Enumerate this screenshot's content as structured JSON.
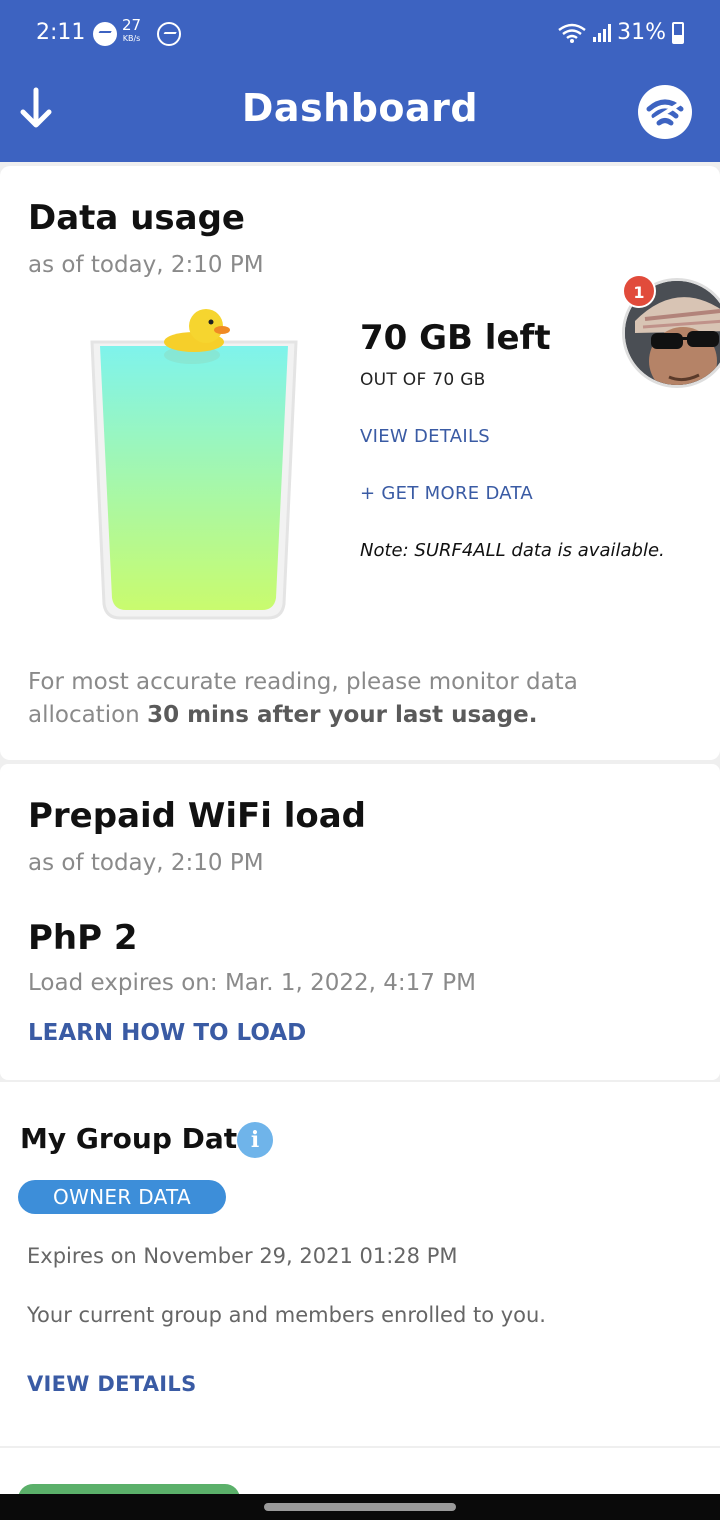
{
  "status_bar": {
    "time": "2:11",
    "speed_value": "27",
    "speed_unit": "KB/s",
    "battery": "31%"
  },
  "header": {
    "title": "Dashboard",
    "back_icon": "arrow-down-icon",
    "action_icon": "wifi-logo-icon",
    "color": "#3d63c1"
  },
  "data_usage": {
    "title": "Data usage",
    "as_of": "as of today, 2:10 PM",
    "amount_left": "70 GB left",
    "out_of": "OUT OF 70 GB",
    "view_details": "VIEW DETAILS",
    "get_more": "+ GET MORE DATA",
    "note": "Note: SURF4ALL data is available.",
    "footnote_prefix": "For most accurate reading, please monitor data allocation ",
    "footnote_bold": "30 mins after your last usage.",
    "fill_level": 1.0,
    "notification_count": "1"
  },
  "prepaid": {
    "title": "Prepaid WiFi load",
    "as_of": "as of today, 2:10 PM",
    "balance": "PhP 2",
    "expires": "Load expires on: Mar. 1, 2022, 4:17 PM",
    "learn_link": "LEARN HOW TO LOAD"
  },
  "group_data": {
    "title": "My Group Data",
    "info_icon": "i",
    "owner_pill": "OWNER DATA",
    "expires": "Expires on November 29, 2021 01:28 PM",
    "description": "Your current group and members enrolled to you.",
    "view_details": "VIEW DETAILS"
  },
  "colors": {
    "accent": "#3d63c1",
    "link": "#3a5ba4",
    "pill_owner": "#3d8ed9",
    "pill_member": "#5bb06a",
    "badge": "#e14b3b"
  }
}
